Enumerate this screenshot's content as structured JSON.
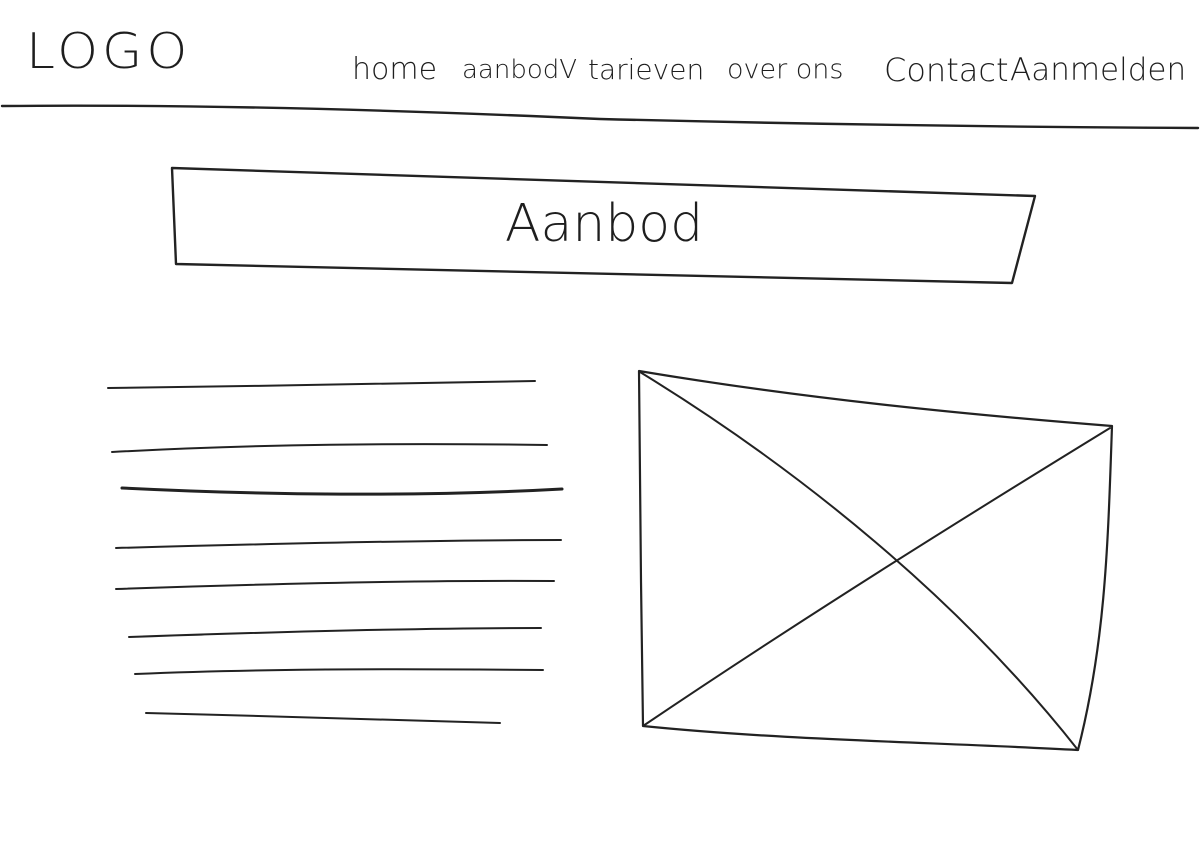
{
  "header": {
    "logo": "LOGO",
    "nav": {
      "home": "home",
      "aanbod": "aanbodV",
      "tarieven": "tarieven",
      "over_ons": "over ons",
      "contact": "Contact",
      "aanmelden": "Aanmelden"
    }
  },
  "banner": {
    "title": "Aanbod"
  },
  "content": {
    "text_lines": 8,
    "image_placeholder": "image-placeholder"
  }
}
